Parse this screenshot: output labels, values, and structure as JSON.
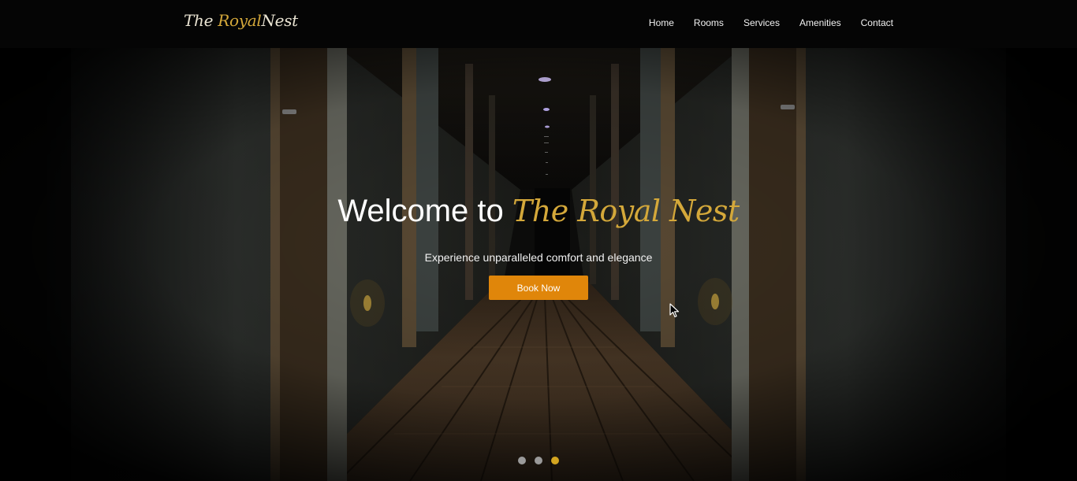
{
  "navbar": {
    "logo": {
      "part1": "The ",
      "part2": "Royal",
      "part3": "Nest"
    },
    "links": [
      "Home",
      "Rooms",
      "Services",
      "Amenities",
      "Contact"
    ]
  },
  "hero": {
    "title_prefix": "Welcome to",
    "title_brand": "The Royal Nest",
    "subtitle": "Experience unparalleled comfort and elegance",
    "cta_label": "Book Now",
    "slides_total": 3,
    "active_slide": 3
  },
  "colors": {
    "accent_gold": "#d4a83a",
    "button_orange": "#e0860a",
    "navbar_bg": "#050505"
  }
}
